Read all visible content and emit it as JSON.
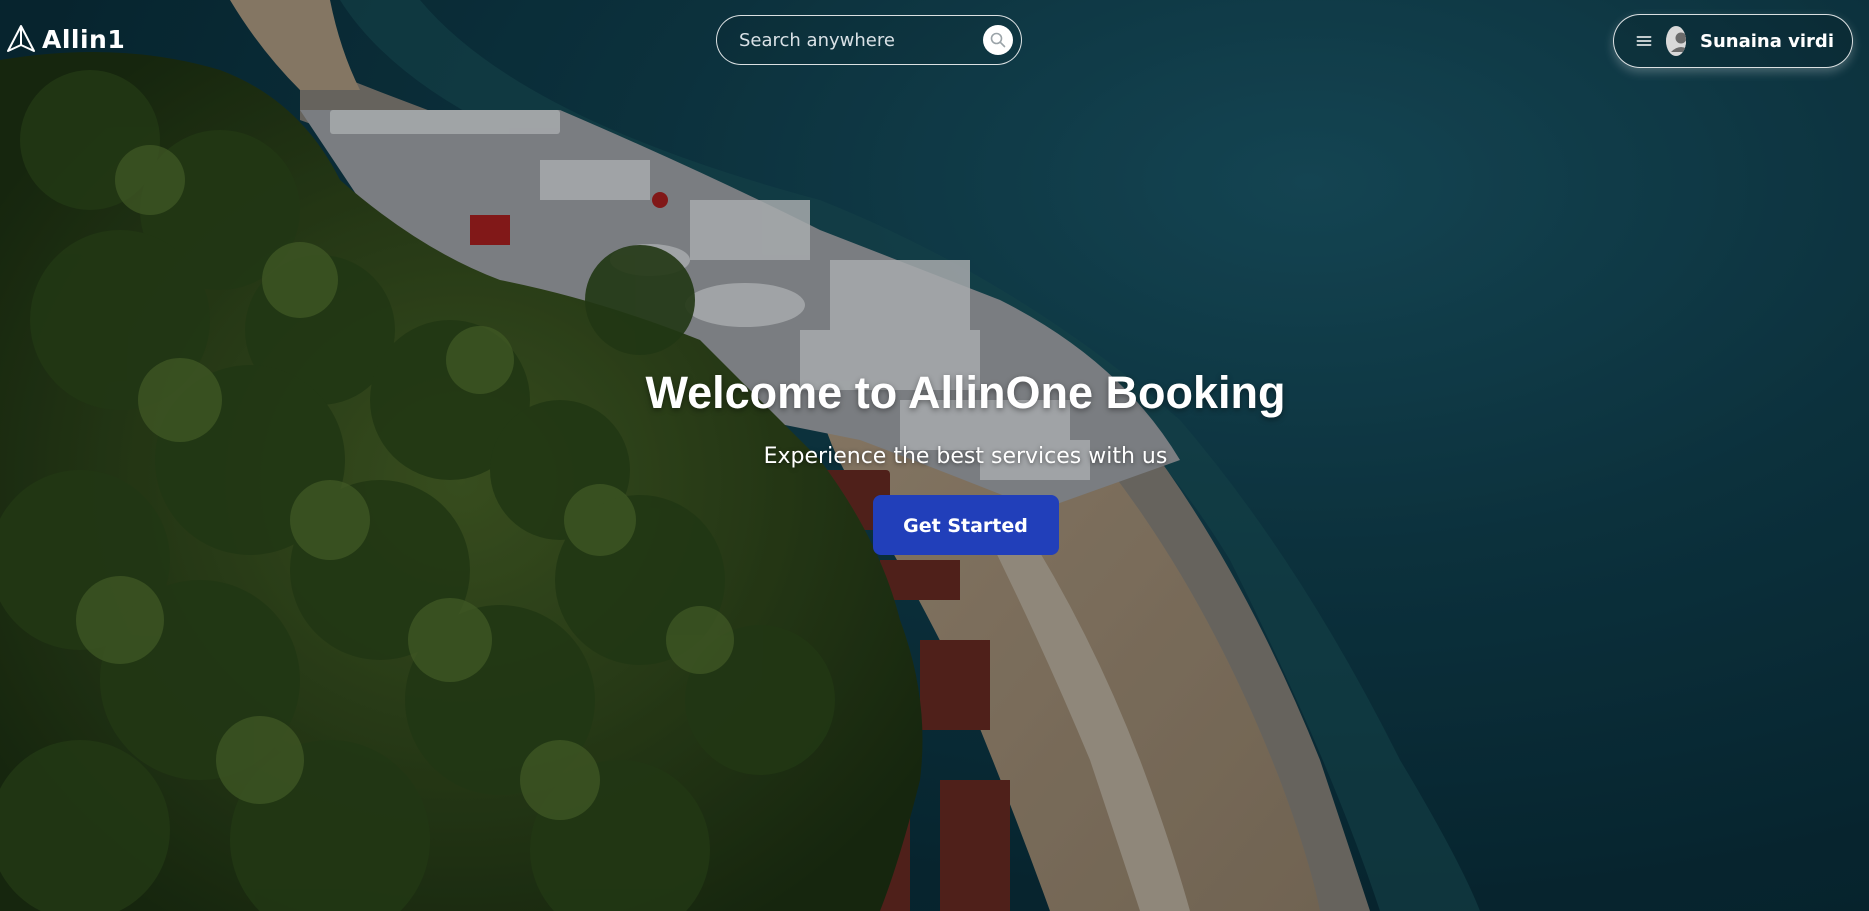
{
  "brand": {
    "name": "Allin1",
    "logo_icon": "triangle-logo-icon"
  },
  "search": {
    "placeholder": "Search anywhere",
    "icon": "search-icon"
  },
  "user_menu": {
    "menu_icon": "hamburger-menu-icon",
    "avatar_icon": "user-avatar-icon",
    "name": "Sunaina virdi"
  },
  "hero": {
    "title": "Welcome to AllinOne Booking",
    "subtitle": "Experience the best services with us",
    "cta_label": "Get Started",
    "background": "aerial-coastline-photo"
  },
  "colors": {
    "cta": "#213fba",
    "text": "#ffffff",
    "sea": "#114555",
    "trees": "#2d4a1e"
  }
}
